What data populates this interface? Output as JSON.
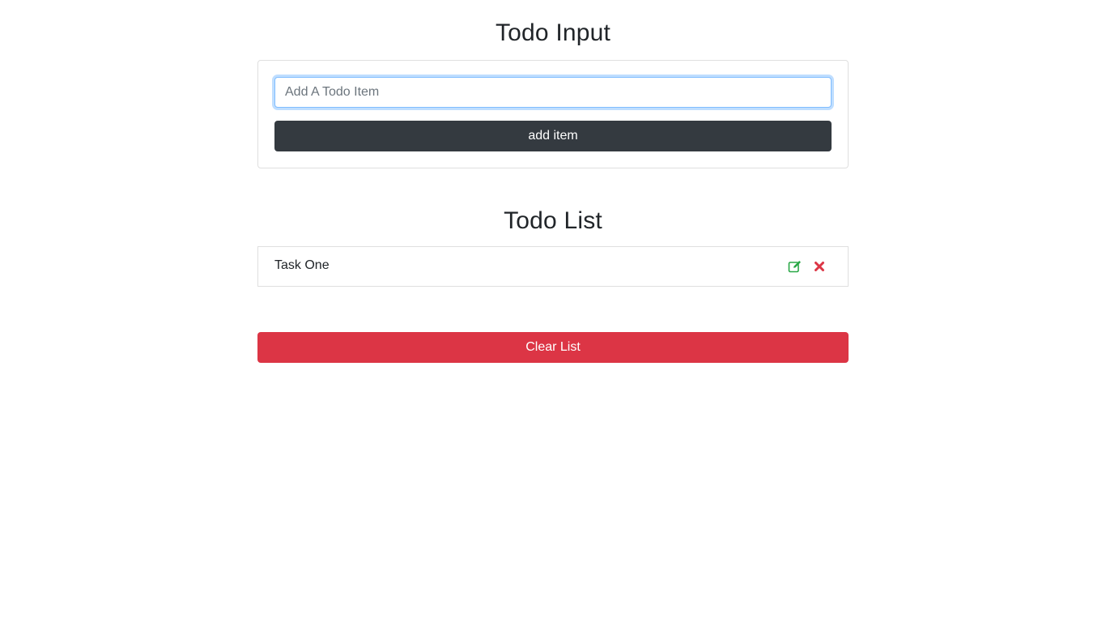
{
  "input_section": {
    "title": "Todo Input",
    "input": {
      "value": "",
      "placeholder": "Add A Todo Item"
    },
    "add_button_label": "add item"
  },
  "list_section": {
    "title": "Todo List",
    "items": [
      {
        "label": "Task One",
        "edit_icon": "edit-icon",
        "delete_icon": "delete-icon"
      }
    ]
  },
  "clear_button_label": "Clear List",
  "colors": {
    "add_button": "#343a40",
    "clear_button": "#dc3545",
    "edit_icon": "#28a745",
    "delete_icon": "#dc3545",
    "input_focus": "#80bdff"
  }
}
